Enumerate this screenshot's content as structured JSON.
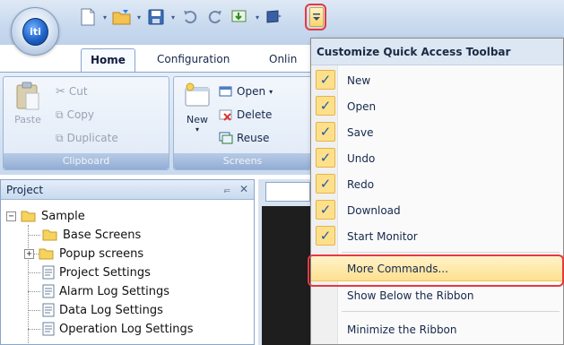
{
  "ribbon": {
    "orb_label": "iti",
    "tabs": [
      {
        "label": "Home"
      },
      {
        "label": "Configuration"
      },
      {
        "label": "Onlin"
      }
    ],
    "clipboard": {
      "paste": "Paste",
      "cut": "Cut",
      "copy": "Copy",
      "duplicate": "Duplicate",
      "group_label": "Clipboard"
    },
    "screens": {
      "new": "New",
      "open": "Open",
      "delete": "Delete",
      "reuse": "Reuse",
      "group_label": "Screens"
    }
  },
  "project_pane": {
    "title": "Project",
    "pin": "⫭",
    "close": "✕",
    "tree": [
      {
        "label": "Sample"
      },
      {
        "label": "Base Screens"
      },
      {
        "label": "Popup screens"
      },
      {
        "label": "Project Settings"
      },
      {
        "label": "Alarm Log Settings"
      },
      {
        "label": "Data Log Settings"
      },
      {
        "label": "Operation Log Settings"
      }
    ]
  },
  "qat_menu": {
    "header": "Customize Quick Access Toolbar",
    "items": [
      {
        "label": "New",
        "checked": true
      },
      {
        "label": "Open",
        "checked": true
      },
      {
        "label": "Save",
        "checked": true
      },
      {
        "label": "Undo",
        "checked": true
      },
      {
        "label": "Redo",
        "checked": true
      },
      {
        "label": "Download",
        "checked": true
      },
      {
        "label": "Start Monitor",
        "checked": true
      },
      {
        "label": "More Commands...",
        "checked": false
      },
      {
        "label": "Show Below the Ribbon",
        "checked": false
      },
      {
        "label": "Minimize the Ribbon",
        "checked": false
      }
    ],
    "check_glyph": "✓"
  },
  "colors": {
    "highlight": "#e53940",
    "menu_hover": "#ffe08f"
  }
}
